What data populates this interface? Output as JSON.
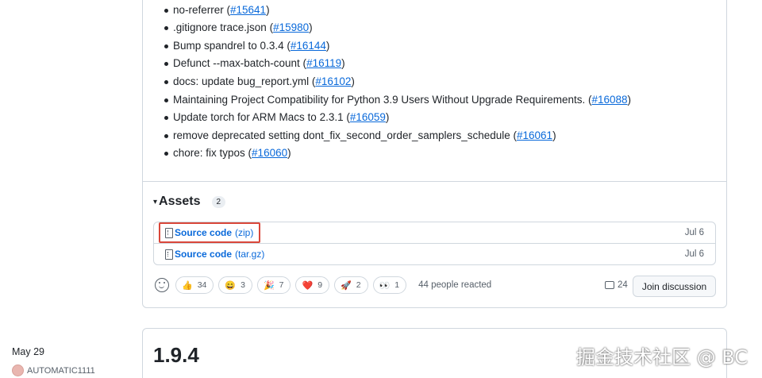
{
  "notes": [
    {
      "text": "no-referrer (",
      "link": "#15641",
      "after": ")"
    },
    {
      "text": ".gitignore trace.json (",
      "link": "#15980",
      "after": ")"
    },
    {
      "text": "Bump spandrel to 0.3.4 (",
      "link": "#16144",
      "after": ")"
    },
    {
      "text": "Defunct --max-batch-count (",
      "link": "#16119",
      "after": ")"
    },
    {
      "text": "docs: update bug_report.yml (",
      "link": "#16102",
      "after": ")"
    },
    {
      "text": "Maintaining Project Compatibility for Python 3.9 Users Without Upgrade Requirements. (",
      "link": "#16088",
      "after": ")"
    },
    {
      "text": "Update torch for ARM Macs to 2.3.1 (",
      "link": "#16059",
      "after": ")"
    },
    {
      "text": "remove deprecated setting dont_fix_second_order_samplers_schedule (",
      "link": "#16061",
      "after": ")"
    },
    {
      "text": "chore: fix typos (",
      "link": "#16060",
      "after": ")"
    }
  ],
  "assets": {
    "caret": "▾",
    "title": "Assets",
    "count": "2",
    "items": [
      {
        "name": "Source code",
        "ext": "(zip)",
        "date": "Jul 6"
      },
      {
        "name": "Source code",
        "ext": "(tar.gz)",
        "date": "Jul 6"
      }
    ]
  },
  "reactions": {
    "items": [
      {
        "emoji": "👍",
        "count": "34"
      },
      {
        "emoji": "😄",
        "count": "3"
      },
      {
        "emoji": "🎉",
        "count": "7"
      },
      {
        "emoji": "❤️",
        "count": "9"
      },
      {
        "emoji": "🚀",
        "count": "2"
      },
      {
        "emoji": "👀",
        "count": "1"
      }
    ],
    "summary": "44 people reacted"
  },
  "discussion": {
    "comment_count": "24",
    "join_label": "Join discussion"
  },
  "next_release": {
    "date": "May 29",
    "author": "AUTOMATIC1111",
    "version": "1.9.4"
  },
  "watermark": "掘金技术社区 @ BC",
  "colors": {
    "link": "#0969da",
    "highlight": "#d9473a",
    "border": "#d0d7de"
  }
}
